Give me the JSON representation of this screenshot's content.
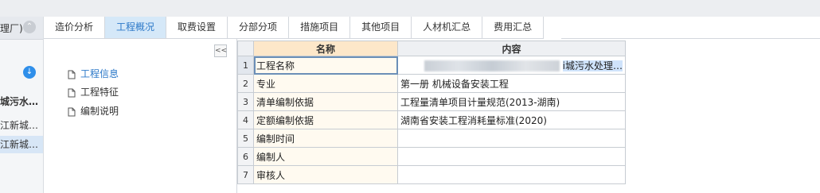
{
  "left_panel": {
    "header_text": "理厂)",
    "items": [
      {
        "label": "城污水…",
        "bold": true
      },
      {
        "label": "江新城…",
        "bold": false
      },
      {
        "label": "江新城…",
        "bold": false,
        "selected": true
      }
    ]
  },
  "tabs": [
    {
      "label": "造价分析"
    },
    {
      "label": "工程概况",
      "active": true
    },
    {
      "label": "取费设置"
    },
    {
      "label": "分部分项"
    },
    {
      "label": "措施项目"
    },
    {
      "label": "其他项目"
    },
    {
      "label": "人材机汇总"
    },
    {
      "label": "费用汇总"
    }
  ],
  "tree": {
    "collapse_glyph": "<<",
    "items": [
      {
        "label": "工程信息",
        "active": true
      },
      {
        "label": "工程特征"
      },
      {
        "label": "编制说明"
      }
    ]
  },
  "grid": {
    "headers": {
      "name": "名称",
      "content": "内容"
    },
    "rows": [
      {
        "num": "1",
        "name": "工程名称",
        "content": "i城污水处理…",
        "selected": true
      },
      {
        "num": "2",
        "name": "专业",
        "content": "第一册 机械设备安装工程"
      },
      {
        "num": "3",
        "name": "清单编制依据",
        "content": "工程量清单项目计量规范(2013-湖南)"
      },
      {
        "num": "4",
        "name": "定额编制依据",
        "content": "湖南省安装工程消耗量标准(2020)"
      },
      {
        "num": "5",
        "name": "编制时间",
        "content": ""
      },
      {
        "num": "6",
        "name": "编制人",
        "content": ""
      },
      {
        "num": "7",
        "name": "审核人",
        "content": ""
      }
    ]
  },
  "colors": {
    "accent": "#2b78c8",
    "active_tab_bg": "#d5e8f8",
    "name_header_bg": "#fde7c9"
  }
}
